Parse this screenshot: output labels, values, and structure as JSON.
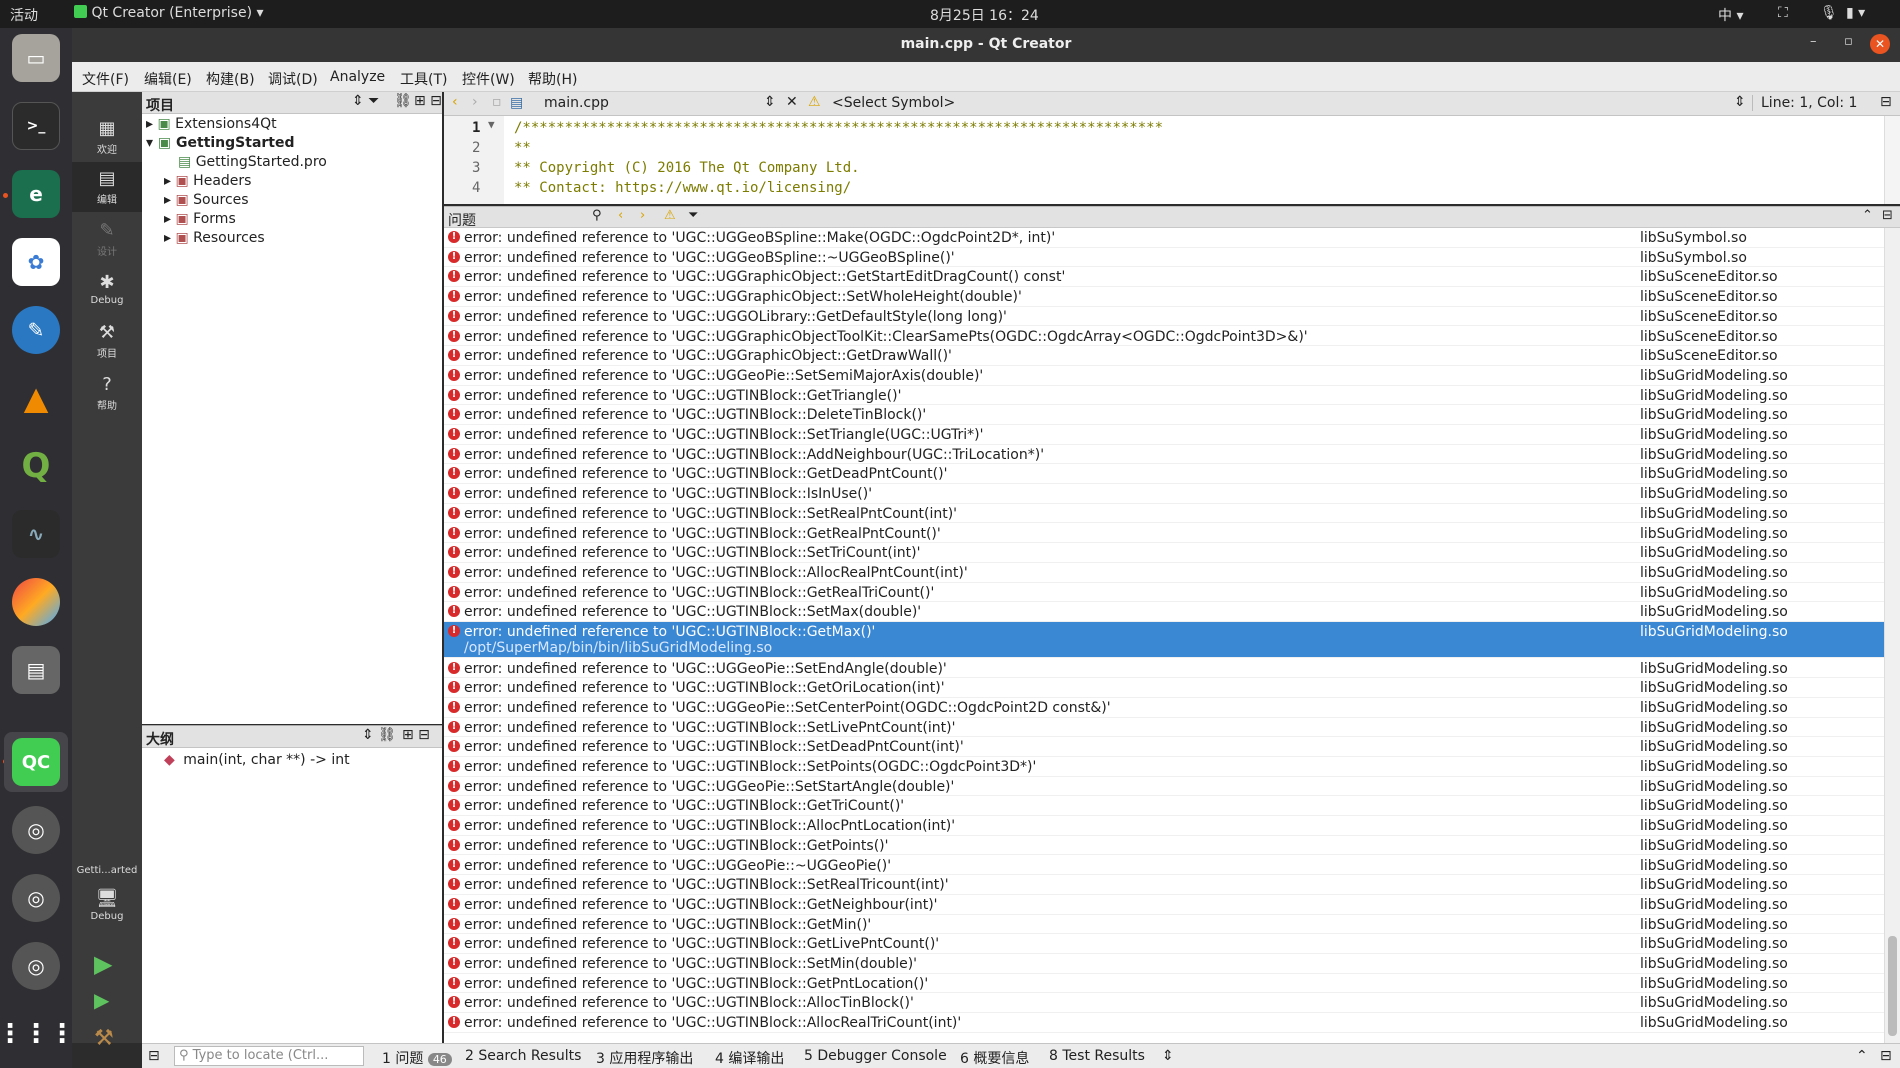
{
  "topbar": {
    "activities": "活动",
    "app": "Qt Creator (Enterprise)",
    "clock": "8月25日 16：24",
    "ime": "中"
  },
  "window": {
    "title": "main.cpp - Qt Creator"
  },
  "menu": [
    "文件(F)",
    "编辑(E)",
    "构建(B)",
    "调试(D)",
    "Analyze",
    "工具(T)",
    "控件(W)",
    "帮助(H)"
  ],
  "modes": [
    {
      "label": "欢迎",
      "icon": "grid-icon"
    },
    {
      "label": "编辑",
      "icon": "edit-icon"
    },
    {
      "label": "设计",
      "icon": "pen-icon"
    },
    {
      "label": "Debug",
      "icon": "bug-icon"
    },
    {
      "label": "项目",
      "icon": "wrench-icon"
    },
    {
      "label": "帮助",
      "icon": "help-icon"
    }
  ],
  "kit": {
    "name": "Getti...arted",
    "mode": "Debug"
  },
  "project_pane": {
    "title": "项目",
    "tree": [
      {
        "label": "Extensions4Qt",
        "level": 0,
        "expanded": false,
        "bold": false
      },
      {
        "label": "GettingStarted",
        "level": 0,
        "expanded": true,
        "bold": true
      },
      {
        "label": "GettingStarted.pro",
        "level": 1,
        "leaf": true
      },
      {
        "label": "Headers",
        "level": 1,
        "expanded": false
      },
      {
        "label": "Sources",
        "level": 1,
        "expanded": false
      },
      {
        "label": "Forms",
        "level": 1,
        "expanded": false
      },
      {
        "label": "Resources",
        "level": 1,
        "expanded": false
      }
    ]
  },
  "outline_pane": {
    "title": "大纲",
    "items": [
      "main(int, char **) -> int"
    ]
  },
  "editor": {
    "file": "main.cpp",
    "symbol": "<Select Symbol>",
    "position": "Line: 1, Col: 1",
    "lines": [
      {
        "n": "1",
        "text": "/****************************************************************************"
      },
      {
        "n": "2",
        "text": "**"
      },
      {
        "n": "3",
        "text": "** Copyright (C) 2016 The Qt Company Ltd."
      },
      {
        "n": "4",
        "text": "** Contact: https://www.qt.io/licensing/"
      }
    ]
  },
  "issues": {
    "title": "问题",
    "selected_path": "/opt/SuperMap/bin/bin/libSuGridModeling.so",
    "rows": [
      {
        "msg": "error: undefined reference to 'UGC::UGGeoBSpline::Make(OGDC::OgdcPoint2D*, int)'",
        "file": "libSuSymbol.so"
      },
      {
        "msg": "error: undefined reference to 'UGC::UGGeoBSpline::~UGGeoBSpline()'",
        "file": "libSuSymbol.so"
      },
      {
        "msg": "error: undefined reference to 'UGC::UGGraphicObject::GetStartEditDragCount() const'",
        "file": "libSuSceneEditor.so"
      },
      {
        "msg": "error: undefined reference to 'UGC::UGGraphicObject::SetWholeHeight(double)'",
        "file": "libSuSceneEditor.so"
      },
      {
        "msg": "error: undefined reference to 'UGC::UGGOLibrary::GetDefaultStyle(long long)'",
        "file": "libSuSceneEditor.so"
      },
      {
        "msg": "error: undefined reference to 'UGC::UGGraphicObjectToolKit::ClearSamePts(OGDC::OgdcArray<OGDC::OgdcPoint3D>&)'",
        "file": "libSuSceneEditor.so"
      },
      {
        "msg": "error: undefined reference to 'UGC::UGGraphicObject::GetDrawWall()'",
        "file": "libSuSceneEditor.so"
      },
      {
        "msg": "error: undefined reference to 'UGC::UGGeoPie::SetSemiMajorAxis(double)'",
        "file": "libSuGridModeling.so"
      },
      {
        "msg": "error: undefined reference to 'UGC::UGTINBlock::GetTriangle()'",
        "file": "libSuGridModeling.so"
      },
      {
        "msg": "error: undefined reference to 'UGC::UGTINBlock::DeleteTinBlock()'",
        "file": "libSuGridModeling.so"
      },
      {
        "msg": "error: undefined reference to 'UGC::UGTINBlock::SetTriangle(UGC::UGTri*)'",
        "file": "libSuGridModeling.so"
      },
      {
        "msg": "error: undefined reference to 'UGC::UGTINBlock::AddNeighbour(UGC::TriLocation*)'",
        "file": "libSuGridModeling.so"
      },
      {
        "msg": "error: undefined reference to 'UGC::UGTINBlock::GetDeadPntCount()'",
        "file": "libSuGridModeling.so"
      },
      {
        "msg": "error: undefined reference to 'UGC::UGTINBlock::IsInUse()'",
        "file": "libSuGridModeling.so"
      },
      {
        "msg": "error: undefined reference to 'UGC::UGTINBlock::SetRealPntCount(int)'",
        "file": "libSuGridModeling.so"
      },
      {
        "msg": "error: undefined reference to 'UGC::UGTINBlock::GetRealPntCount()'",
        "file": "libSuGridModeling.so"
      },
      {
        "msg": "error: undefined reference to 'UGC::UGTINBlock::SetTriCount(int)'",
        "file": "libSuGridModeling.so"
      },
      {
        "msg": "error: undefined reference to 'UGC::UGTINBlock::AllocRealPntCount(int)'",
        "file": "libSuGridModeling.so"
      },
      {
        "msg": "error: undefined reference to 'UGC::UGTINBlock::GetRealTriCount()'",
        "file": "libSuGridModeling.so"
      },
      {
        "msg": "error: undefined reference to 'UGC::UGTINBlock::SetMax(double)'",
        "file": "libSuGridModeling.so"
      },
      {
        "msg": "error: undefined reference to 'UGC::UGTINBlock::GetMax()'",
        "file": "libSuGridModeling.so",
        "selected": true
      },
      {
        "msg": "error: undefined reference to 'UGC::UGGeoPie::SetEndAngle(double)'",
        "file": "libSuGridModeling.so"
      },
      {
        "msg": "error: undefined reference to 'UGC::UGTINBlock::GetOriLocation(int)'",
        "file": "libSuGridModeling.so"
      },
      {
        "msg": "error: undefined reference to 'UGC::UGGeoPie::SetCenterPoint(OGDC::OgdcPoint2D const&)'",
        "file": "libSuGridModeling.so"
      },
      {
        "msg": "error: undefined reference to 'UGC::UGTINBlock::SetLivePntCount(int)'",
        "file": "libSuGridModeling.so"
      },
      {
        "msg": "error: undefined reference to 'UGC::UGTINBlock::SetDeadPntCount(int)'",
        "file": "libSuGridModeling.so"
      },
      {
        "msg": "error: undefined reference to 'UGC::UGTINBlock::SetPoints(OGDC::OgdcPoint3D*)'",
        "file": "libSuGridModeling.so"
      },
      {
        "msg": "error: undefined reference to 'UGC::UGGeoPie::SetStartAngle(double)'",
        "file": "libSuGridModeling.so"
      },
      {
        "msg": "error: undefined reference to 'UGC::UGTINBlock::GetTriCount()'",
        "file": "libSuGridModeling.so"
      },
      {
        "msg": "error: undefined reference to 'UGC::UGTINBlock::AllocPntLocation(int)'",
        "file": "libSuGridModeling.so"
      },
      {
        "msg": "error: undefined reference to 'UGC::UGTINBlock::GetPoints()'",
        "file": "libSuGridModeling.so"
      },
      {
        "msg": "error: undefined reference to 'UGC::UGGeoPie::~UGGeoPie()'",
        "file": "libSuGridModeling.so"
      },
      {
        "msg": "error: undefined reference to 'UGC::UGTINBlock::SetRealTricount(int)'",
        "file": "libSuGridModeling.so"
      },
      {
        "msg": "error: undefined reference to 'UGC::UGTINBlock::GetNeighbour(int)'",
        "file": "libSuGridModeling.so"
      },
      {
        "msg": "error: undefined reference to 'UGC::UGTINBlock::GetMin()'",
        "file": "libSuGridModeling.so"
      },
      {
        "msg": "error: undefined reference to 'UGC::UGTINBlock::GetLivePntCount()'",
        "file": "libSuGridModeling.so"
      },
      {
        "msg": "error: undefined reference to 'UGC::UGTINBlock::SetMin(double)'",
        "file": "libSuGridModeling.so"
      },
      {
        "msg": "error: undefined reference to 'UGC::UGTINBlock::GetPntLocation()'",
        "file": "libSuGridModeling.so"
      },
      {
        "msg": "error: undefined reference to 'UGC::UGTINBlock::AllocTinBlock()'",
        "file": "libSuGridModeling.so"
      },
      {
        "msg": "error: undefined reference to 'UGC::UGTINBlock::AllocRealTriCount(int)'",
        "file": "libSuGridModeling.so"
      }
    ]
  },
  "statusbar": {
    "locate_placeholder": "Type to locate (Ctrl...",
    "tabs": [
      {
        "label": "1 问题",
        "badge": "46"
      },
      {
        "label": "2 Search Results"
      },
      {
        "label": "3 应用程序输出"
      },
      {
        "label": "4 编译输出"
      },
      {
        "label": "5 Debugger Console"
      },
      {
        "label": "6 概要信息"
      },
      {
        "label": "8 Test Results"
      }
    ]
  },
  "colors": {
    "accent": "#3a87d4",
    "error": "#d82a2a",
    "qc_green": "#41cd52"
  }
}
